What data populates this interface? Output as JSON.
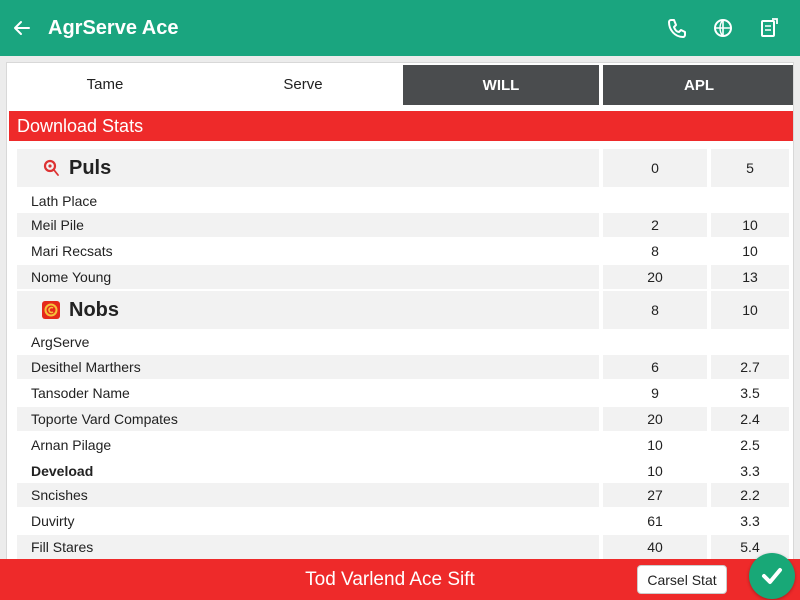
{
  "app_bar": {
    "title": "AgrServe Ace",
    "back_icon": "arrow-left-icon",
    "actions": [
      "phone-icon",
      "globe-icon",
      "clipboard-icon"
    ],
    "bg_color": "#1aa57f"
  },
  "tabs": [
    {
      "label": "Tame",
      "style": "light"
    },
    {
      "label": "Serve",
      "style": "light"
    },
    {
      "label": "WILL",
      "style": "dark"
    },
    {
      "label": "APL",
      "style": "dark"
    }
  ],
  "section": {
    "title": "Download Stats",
    "color": "#ee2a2a"
  },
  "rows": [
    {
      "type": "group",
      "icon": "pin-icon",
      "name": "Puls",
      "v1": "0",
      "v2": "5"
    },
    {
      "type": "sub",
      "name": "Lath Place",
      "v1": "",
      "v2": ""
    },
    {
      "type": "item",
      "name": "Meil Pile",
      "v1": "2",
      "v2": "10"
    },
    {
      "type": "item",
      "name": "Mari Recsats",
      "v1": "8",
      "v2": "10"
    },
    {
      "type": "item",
      "name": "Nome Young",
      "v1": "20",
      "v2": "13"
    },
    {
      "type": "group",
      "icon": "badge-icon",
      "name": "Nobs",
      "v1": "8",
      "v2": "10"
    },
    {
      "type": "sub",
      "name": "ArgServe",
      "v1": "",
      "v2": ""
    },
    {
      "type": "item",
      "name": "Desithel Marthers",
      "v1": "6",
      "v2": "2.7"
    },
    {
      "type": "item",
      "name": "Tansoder Name",
      "v1": "9",
      "v2": "3.5"
    },
    {
      "type": "item",
      "name": "Toporte Vard Compates",
      "v1": "20",
      "v2": "2.4"
    },
    {
      "type": "item",
      "name": "Arnan Pilage",
      "v1": "10",
      "v2": "2.5"
    },
    {
      "type": "bold",
      "name": "Deveload",
      "v1": "10",
      "v2": "3.3"
    },
    {
      "type": "item",
      "name": "Sncishes",
      "v1": "27",
      "v2": "2.2"
    },
    {
      "type": "item",
      "name": "Duvirty",
      "v1": "61",
      "v2": "3.3"
    },
    {
      "type": "item",
      "name": "Fill Stares",
      "v1": "40",
      "v2": "5.4"
    }
  ],
  "footer": {
    "text": "Tod Varlend Ace Sift",
    "button_label": "Carsel Stat",
    "fab_icon": "checkmark-icon"
  }
}
